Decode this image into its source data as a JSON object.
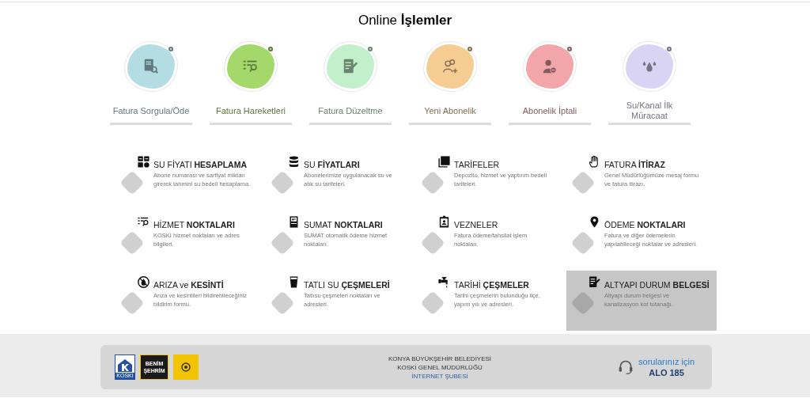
{
  "heading": "Online **İşlemler**",
  "online_operations": [
    {
      "label": "Fatura Sorgula/Öde",
      "color": "#b3dde3",
      "kind": "search-doc"
    },
    {
      "label": "Fatura Hareketleri",
      "color": "#a5d86a",
      "kind": "list-search"
    },
    {
      "label": "Fatura Düzeltme",
      "color": "#c2f0cb",
      "kind": "edit-doc"
    },
    {
      "label": "Yeni Abonelik",
      "color": "#f5cd93",
      "kind": "user-add"
    },
    {
      "label": "Abonelik İptali",
      "color": "#f2a6aa",
      "kind": "user-remove"
    },
    {
      "label": "Su/Kanal İlk Müracaat",
      "color": "#d9d3f4",
      "kind": "drops"
    }
  ],
  "services": [
    {
      "title": "SU FİYATI **HESAPLAMA**",
      "description": "Abone numarası ve sarfiyat miktarı girerek tahmini su bedeli hesaplama.",
      "kind": "calculator",
      "selected": false
    },
    {
      "title": "SU **FİYATLARI**",
      "description": "Abonelerimize uygulanacak su ve atık su tarifeleri.",
      "kind": "database",
      "selected": false
    },
    {
      "title": "TARİFELER",
      "description": "Depozito, hizmet ve yaptırım bedeli tarifeleri.",
      "kind": "copy",
      "selected": false
    },
    {
      "title": "FATURA **İTİRAZ**",
      "description": "Genel Müdürlüğümüze mesaj formu ve fatura itirazı.",
      "kind": "hand",
      "selected": false
    },
    {
      "title": "HİZMET **NOKTALARI**",
      "description": "KOSKİ hizmet noktaları ve adres bilgileri.",
      "kind": "list-search",
      "selected": false
    },
    {
      "title": "SUMAT **NOKTALARI**",
      "description": "SUMAT otomatik ödeme hizmet noktaları.",
      "kind": "kiosk",
      "selected": false
    },
    {
      "title": "VEZNELER",
      "description": "Fatura ödeme/tahsilat işlem noktaları.",
      "kind": "badge",
      "selected": false
    },
    {
      "title": "ÖDEME **NOKTALARI**",
      "description": "Fatura ve diğer ödemelerin yapılabileceği noktalar ve adresleri.",
      "kind": "pin",
      "selected": false
    },
    {
      "title": "ARIZA ve **KESİNTİ**",
      "description": "Arıza ve kesintileri bildirebileceğiniz bildirim formu.",
      "kind": "no-drop",
      "selected": false
    },
    {
      "title": "TATLI SU **ÇEŞMELERİ**",
      "description": "Tatlısu çeşmeleri noktaları ve adresleri.",
      "kind": "glass",
      "selected": false
    },
    {
      "title": "TARİHİ **ÇEŞMELER**",
      "description": "Tarihi çeşmelerin bulunduğu ilçe, yapım yılı ve adresleri.",
      "kind": "tap",
      "selected": false
    },
    {
      "title": "ALTYAPI DURUM **BELGESİ**",
      "description": "Altyapı durum belgesi ve kanalizasyon kot tutanağı.",
      "kind": "edit-doc",
      "selected": true
    }
  ],
  "footer": {
    "logos": [
      {
        "kind": "koski",
        "text": "KOSKİ"
      },
      {
        "kind": "benim",
        "text": "BENİM ŞEHRİM"
      },
      {
        "kind": "konya"
      }
    ],
    "lines": [
      "KONYA BÜYÜKŞEHİR BELEDİYESİ",
      "KOSKİ GENEL MÜDÜRLÜĞÜ"
    ],
    "link": "İNTERNET ŞUBESİ",
    "help_text": "sorularınız için",
    "phone": "ALO 185"
  }
}
